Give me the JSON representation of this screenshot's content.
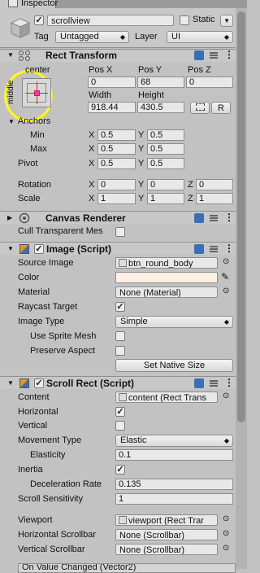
{
  "tab": {
    "title": "Inspector"
  },
  "header": {
    "name_value": "scrollview",
    "static_label": "Static",
    "tag_label": "Tag",
    "tag_value": "Untagged",
    "layer_label": "Layer",
    "layer_value": "UI"
  },
  "rect_transform": {
    "title": "Rect Transform",
    "anchor_preset_top": "center",
    "anchor_preset_side": "middle",
    "pos_x_label": "Pos X",
    "pos_y_label": "Pos Y",
    "pos_z_label": "Pos Z",
    "pos_x": "0",
    "pos_y": "68",
    "pos_z": "0",
    "width_label": "Width",
    "height_label": "Height",
    "width": "918.44",
    "height": "430.5",
    "raw_button": "R",
    "anchors_label": "Anchors",
    "min_label": "Min",
    "max_label": "Max",
    "min_x": "0.5",
    "min_y": "0.5",
    "max_x": "0.5",
    "max_y": "0.5",
    "pivot_label": "Pivot",
    "pivot_x": "0.5",
    "pivot_y": "0.5",
    "rotation_label": "Rotation",
    "rot_x": "0",
    "rot_y": "0",
    "rot_z": "0",
    "scale_label": "Scale",
    "scale_x": "1",
    "scale_y": "1",
    "scale_z": "1",
    "x": "X",
    "y": "Y",
    "z": "Z"
  },
  "canvas_renderer": {
    "title": "Canvas Renderer",
    "cull_label": "Cull Transparent Mes"
  },
  "image": {
    "title": "Image (Script)",
    "source_label": "Source Image",
    "source_value": "btn_round_body",
    "color_label": "Color",
    "color_value": "#fdf1e6",
    "material_label": "Material",
    "material_value": "None (Material)",
    "raycast_label": "Raycast Target",
    "type_label": "Image Type",
    "type_value": "Simple",
    "sprite_mesh_label": "Use Sprite Mesh",
    "preserve_label": "Preserve Aspect",
    "native_button": "Set Native Size"
  },
  "scroll_rect": {
    "title": "Scroll Rect (Script)",
    "content_label": "Content",
    "content_value": "content (Rect Trans",
    "horizontal_label": "Horizontal",
    "vertical_label": "Vertical",
    "movement_label": "Movement Type",
    "movement_value": "Elastic",
    "elasticity_label": "Elasticity",
    "elasticity_value": "0.1",
    "inertia_label": "Inertia",
    "decel_label": "Deceleration Rate",
    "decel_value": "0.135",
    "sensitivity_label": "Scroll Sensitivity",
    "sensitivity_value": "1",
    "viewport_label": "Viewport",
    "viewport_value": "viewport (Rect Trar",
    "hscroll_label": "Horizontal Scrollbar",
    "hscroll_value": "None (Scrollbar)",
    "vscroll_label": "Vertical Scrollbar",
    "vscroll_value": "None (Scrollbar)",
    "bottom_partial": "On Value Changed (Vector2)"
  },
  "colors": {
    "highlight": "#ffff00",
    "panel": "#c2c2c2"
  }
}
